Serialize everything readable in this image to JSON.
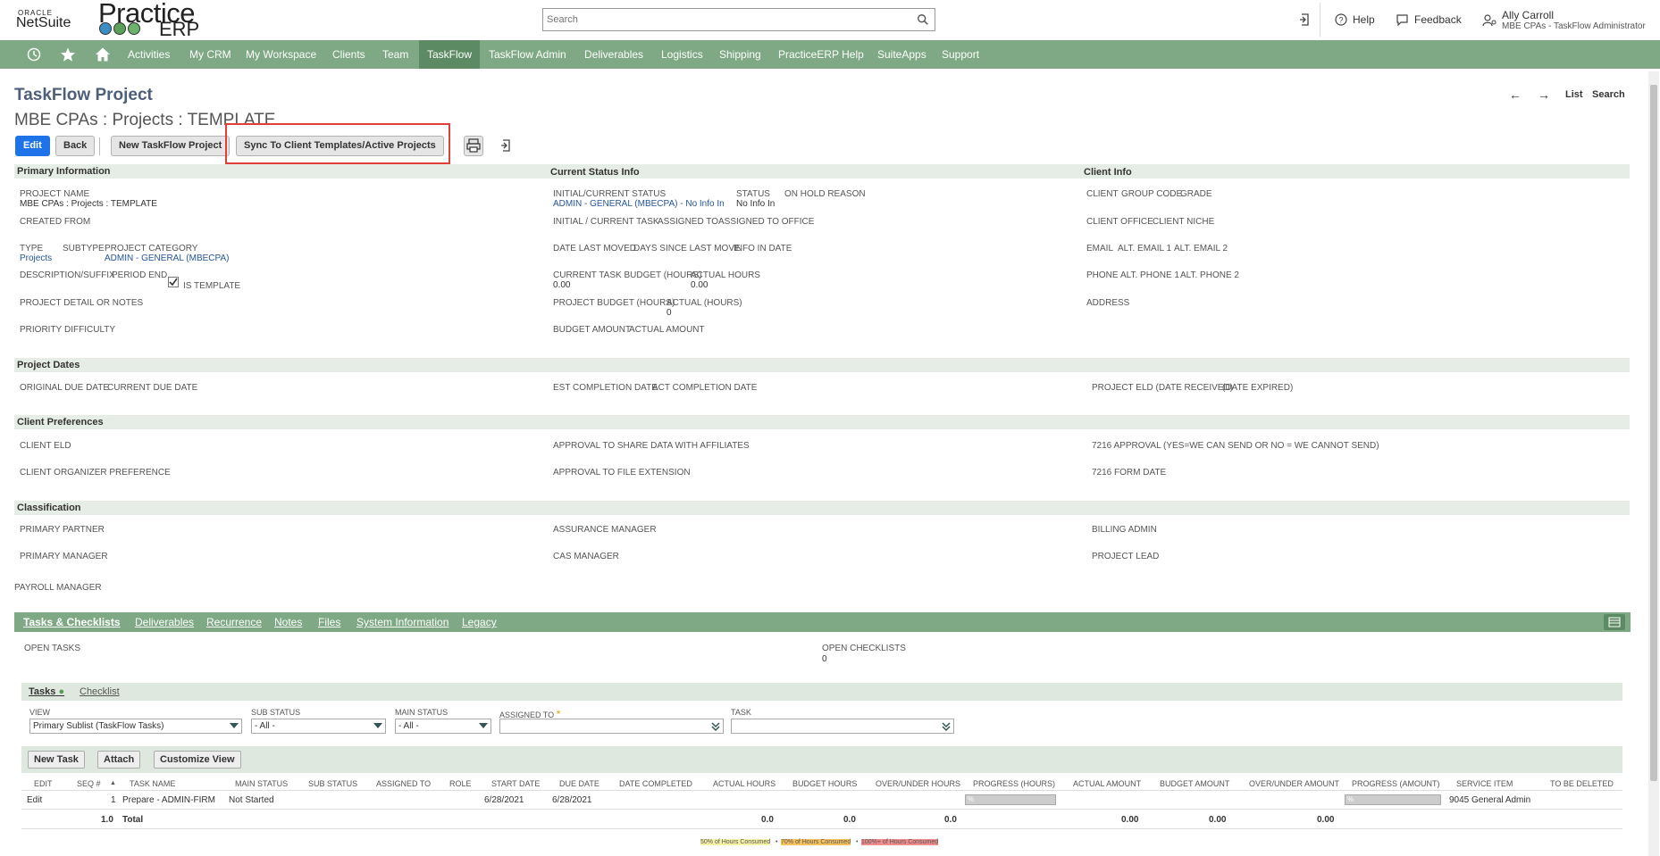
{
  "brand": {
    "oracle": "ORACLE",
    "netsuite": "NetSuite",
    "practice": "Practice",
    "erp": "ERP"
  },
  "search": {
    "placeholder": "Search"
  },
  "header": {
    "help": "Help",
    "feedback": "Feedback",
    "user_name": "Ally Carroll",
    "user_role": "MBE CPAs - TaskFlow Administrator"
  },
  "nav": {
    "items": [
      "Activities",
      "My CRM",
      "My Workspace",
      "Clients",
      "Team",
      "TaskFlow",
      "TaskFlow Admin",
      "Deliverables",
      "Logistics",
      "Shipping",
      "PracticeERP Help",
      "SuiteApps",
      "Support"
    ],
    "active": "TaskFlow"
  },
  "page": {
    "type": "TaskFlow Project",
    "title": "MBE CPAs : Projects : TEMPLATE",
    "list": "List",
    "search": "Search"
  },
  "toolbar": {
    "edit": "Edit",
    "back": "Back",
    "new": "New TaskFlow Project",
    "sync": "Sync To Client Templates/Active Projects"
  },
  "sections": {
    "primary": "Primary Information",
    "status": "Current Status Info",
    "client": "Client Info",
    "dates": "Project Dates",
    "prefs": "Client Preferences",
    "classification": "Classification"
  },
  "primary": {
    "project_name_lbl": "PROJECT NAME",
    "project_name": "MBE CPAs : Projects : TEMPLATE",
    "created_from": "CREATED FROM",
    "type": "TYPE",
    "subtype": "SUBTYPE",
    "project_category": "PROJECT CATEGORY",
    "type_val": "Projects",
    "category_val": "ADMIN - GENERAL (MBECPA)",
    "description": "DESCRIPTION/SUFFIX",
    "period_end": "PERIOD END",
    "is_template": "IS TEMPLATE",
    "detail": "PROJECT DETAIL OR NOTES",
    "priority": "PRIORITY",
    "difficulty": "DIFFICULTY"
  },
  "status": {
    "initial_current": "INITIAL/CURRENT STATUS",
    "initial_current_val": "ADMIN - GENERAL (MBECPA) - No Info In",
    "status": "STATUS",
    "status_val": "No Info In",
    "on_hold": "ON HOLD REASON",
    "task": "INITIAL / CURRENT TASK",
    "assigned_to": "ASSIGNED TO",
    "assigned_office": "ASSIGNED TO OFFICE",
    "date_last_moved": "DATE LAST MOVED",
    "days_since": "DAYS SINCE LAST MOVE",
    "info_in": "INFO IN DATE",
    "task_budget": "CURRENT TASK BUDGET (HOURS)",
    "task_budget_val": "0.00",
    "actual_hours": "ACTUAL HOURS",
    "actual_hours_val": "0.00",
    "proj_budget": "PROJECT BUDGET (HOURS)",
    "actual_hours2": "ACTUAL (HOURS)",
    "actual_hours2_val": "0",
    "budget_amount": "BUDGET AMOUNT",
    "actual_amount": "ACTUAL AMOUNT"
  },
  "client": {
    "client": "CLIENT",
    "group_code": "GROUP CODE",
    "grade": "GRADE",
    "office": "CLIENT OFFICE",
    "niche": "CLIENT NICHE",
    "email": "EMAIL",
    "alt1": "ALT. EMAIL 1",
    "alt2": "ALT. EMAIL 2",
    "phone": "PHONE",
    "altp1": "ALT. PHONE 1",
    "altp2": "ALT. PHONE 2",
    "address": "ADDRESS"
  },
  "dates": {
    "orig_due": "ORIGINAL DUE DATE",
    "cur_due": "CURRENT DUE DATE",
    "est": "EST COMPLETION DATE",
    "act": "ACT COMPLETION DATE",
    "eld": "PROJECT ELD (DATE RECEIVED)",
    "expired": "(DATE EXPIRED)"
  },
  "prefs": {
    "eld": "CLIENT ELD",
    "share": "APPROVAL TO SHARE DATA WITH AFFILIATES",
    "approval7216": "7216 APPROVAL (YES=WE CAN SEND OR NO = WE CANNOT SEND)",
    "organizer": "CLIENT ORGANIZER PREFERENCE",
    "extension": "APPROVAL TO FILE EXTENSION",
    "form7216": "7216 FORM DATE"
  },
  "classification": {
    "partner": "PRIMARY PARTNER",
    "assurance": "ASSURANCE MANAGER",
    "billing": "BILLING ADMIN",
    "manager": "PRIMARY MANAGER",
    "cas": "CAS MANAGER",
    "lead": "PROJECT LEAD",
    "payroll": "PAYROLL MANAGER"
  },
  "subtabs": [
    "Tasks & Checklists",
    "Deliverables",
    "Recurrence",
    "Notes",
    "Files",
    "System Information",
    "Legacy"
  ],
  "open": {
    "tasks": "OPEN TASKS",
    "checklists": "OPEN CHECKLISTS",
    "checklists_val": "0"
  },
  "innertabs": {
    "tasks": "Tasks",
    "checklist": "Checklist"
  },
  "filters": {
    "view": "VIEW",
    "view_val": "Primary Sublist (TaskFlow Tasks)",
    "sub_status": "SUB STATUS",
    "sub_status_val": "- All -",
    "main_status": "MAIN STATUS",
    "main_status_val": "- All -",
    "assigned_to": "ASSIGNED TO",
    "task": "TASK"
  },
  "subbuttons": {
    "new_task": "New Task",
    "attach": "Attach",
    "customize": "Customize View"
  },
  "table": {
    "headers": [
      "EDIT",
      "SEQ #",
      "TASK NAME",
      "MAIN STATUS",
      "SUB STATUS",
      "ASSIGNED TO",
      "ROLE",
      "START DATE",
      "DUE DATE",
      "DATE COMPLETED",
      "ACTUAL HOURS",
      "BUDGET HOURS",
      "OVER/UNDER HOURS",
      "PROGRESS (HOURS)",
      "ACTUAL AMOUNT",
      "BUDGET AMOUNT",
      "OVER/UNDER AMOUNT",
      "PROGRESS (AMOUNT)",
      "SERVICE ITEM",
      "TO BE DELETED"
    ],
    "row": {
      "edit": "Edit",
      "seq": "1",
      "task": "Prepare - ADMIN-FIRM",
      "main_status": "Not Started",
      "start": "6/28/2021",
      "due": "6/28/2021",
      "service": "9045 General Admin",
      "progress_hours": "%",
      "progress_amount": "%"
    },
    "total": {
      "seq": "1.0",
      "label": "Total",
      "actual_hours": "0.0",
      "budget_hours": "0.0",
      "over_under": "0.0",
      "actual_amount": "0.00",
      "budget_amount": "0.00",
      "over_under_amount": "0.00"
    }
  },
  "legend": {
    "l50": "50% of Hours Consumed",
    "l70": "70% of Hours Consumed",
    "l100": "100%+ of Hours Consumed",
    "dot": "•"
  }
}
